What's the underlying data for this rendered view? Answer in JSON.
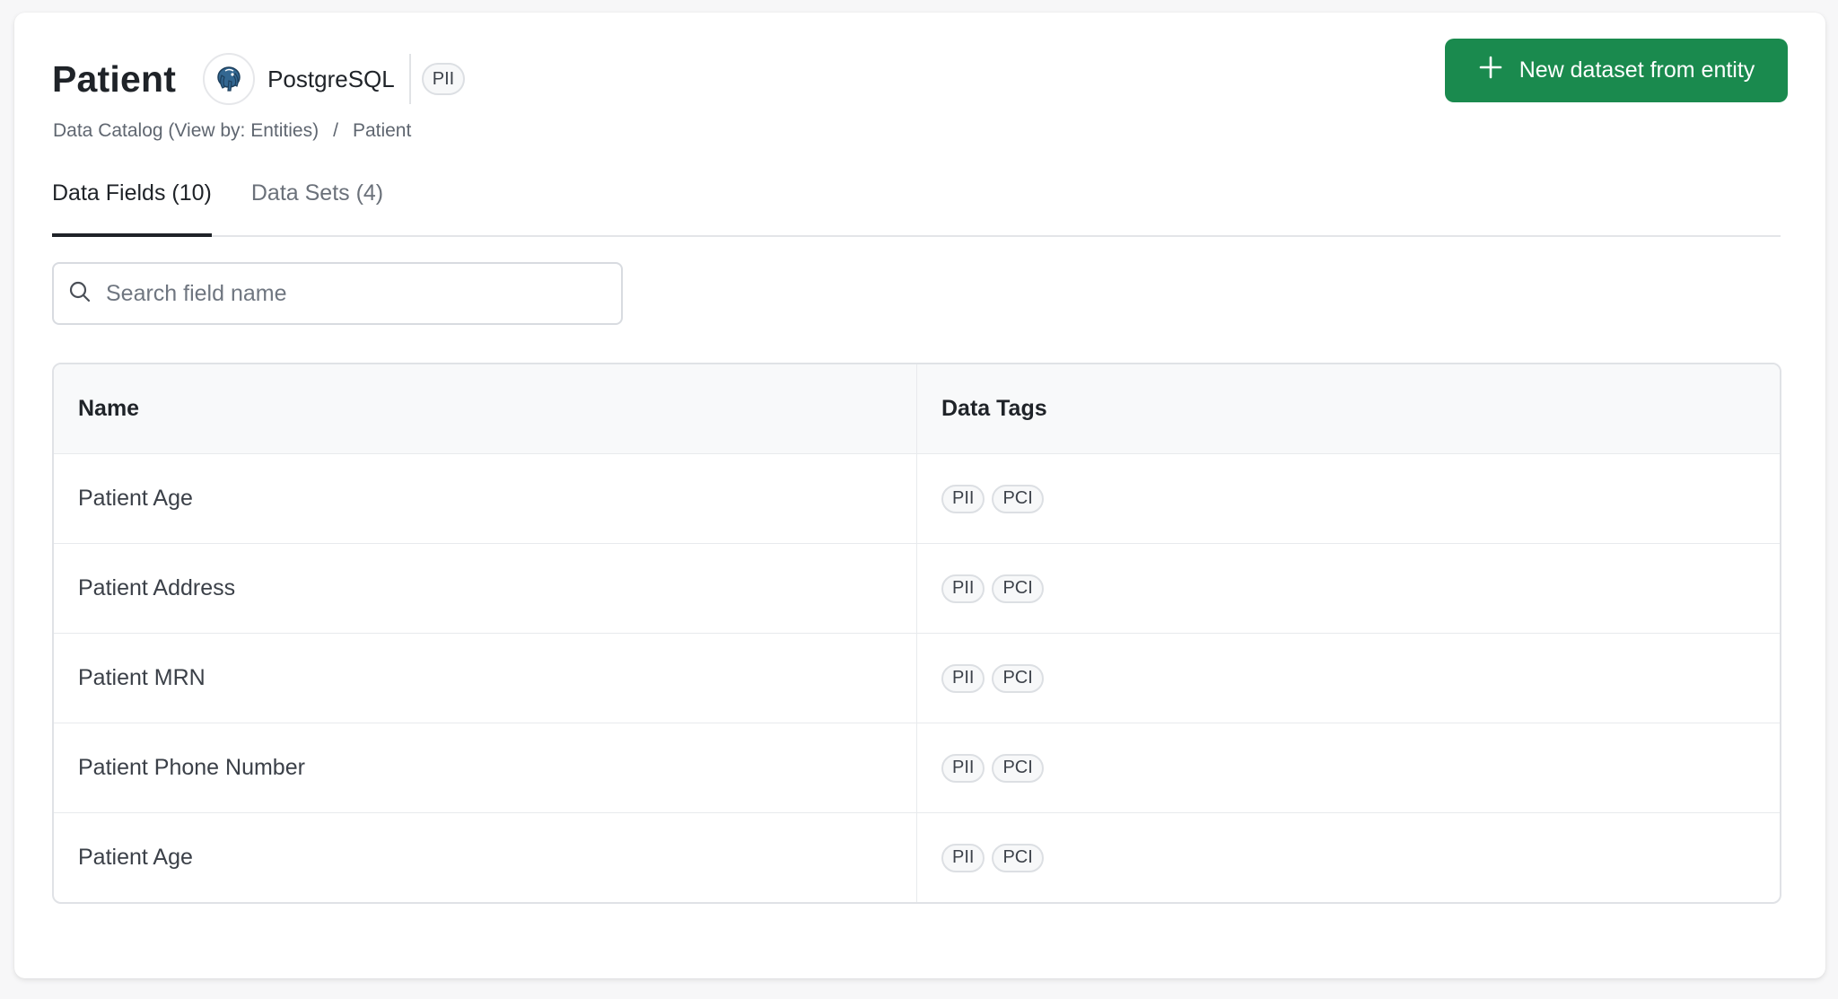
{
  "header": {
    "title": "Patient",
    "db_icon": "postgresql-elephant-icon",
    "db_name": "PostgreSQL",
    "entity_tag": "PII"
  },
  "breadcrumb": {
    "root": "Data Catalog (View by: Entities)",
    "separator": "/",
    "current": "Patient"
  },
  "actions": {
    "new_dataset_label": "New dataset from entity",
    "new_dataset_icon": "plus-icon",
    "accent_color": "#1a8a4e"
  },
  "tabs": [
    {
      "label": "Data Fields (10)",
      "active": true
    },
    {
      "label": "Data Sets (4)",
      "active": false
    }
  ],
  "search": {
    "placeholder": "Search field name",
    "value": "",
    "icon": "search-icon"
  },
  "table": {
    "columns": [
      "Name",
      "Data Tags"
    ],
    "rows": [
      {
        "name": "Patient Age",
        "tags": [
          "PII",
          "PCI"
        ]
      },
      {
        "name": "Patient Address",
        "tags": [
          "PII",
          "PCI"
        ]
      },
      {
        "name": "Patient MRN",
        "tags": [
          "PII",
          "PCI"
        ]
      },
      {
        "name": "Patient Phone Number",
        "tags": [
          "PII",
          "PCI"
        ]
      },
      {
        "name": "Patient Age",
        "tags": [
          "PII",
          "PCI"
        ]
      }
    ]
  }
}
